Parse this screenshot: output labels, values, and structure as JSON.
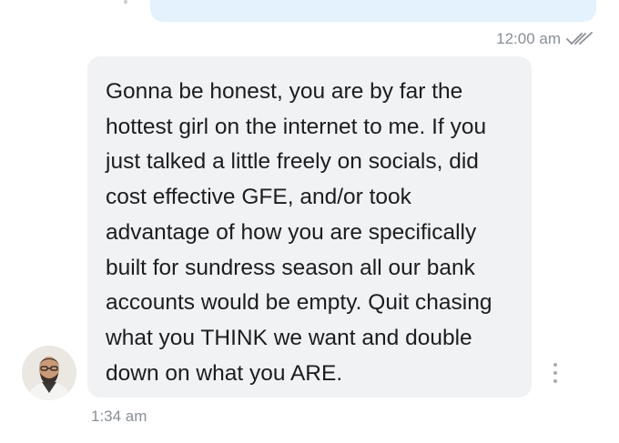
{
  "conversation": {
    "outgoing": {
      "time": "12:00 am",
      "status_icon": "double-check-icon"
    },
    "incoming": {
      "text": "Gonna be honest, you are by far the\nhottest girl on the internet to me. If you\njust talked a little freely on socials, did\ncost effective GFE, and/or took\nadvantage of how you are specifically\nbuilt for sundress season all our bank\naccounts would be empty. Quit chasing\nwhat you THINK we want and double\ndown on what you ARE.",
      "time": "1:34 am",
      "sender_avatar": "avatar-photo",
      "menu_icon": "more-vertical-icon"
    }
  },
  "colors": {
    "outgoing_bubble": "#e3f2fd",
    "incoming_bubble": "#f1f2f4",
    "meta_text": "#8a8f96",
    "message_text": "#1b1d20"
  }
}
